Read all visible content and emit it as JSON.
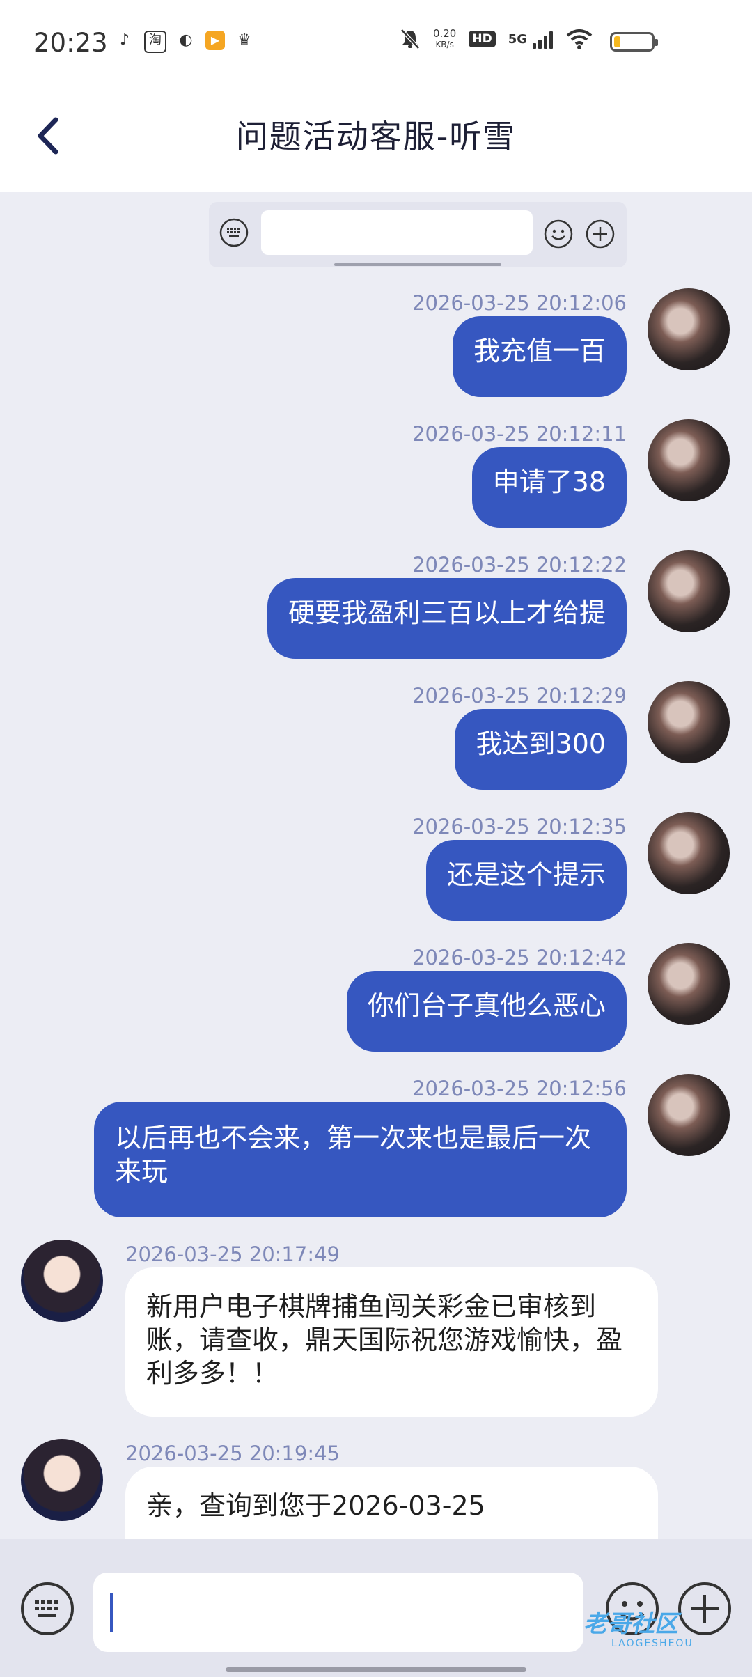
{
  "status_bar": {
    "time": "20:23",
    "apps": [
      "♪",
      "淘",
      "◐",
      "▶",
      "♛"
    ],
    "net_speed": "0.20",
    "net_unit": "KB/s",
    "hd": "HD",
    "network": "5G",
    "battery_level": 0.18,
    "battery_color": "#f5b81f"
  },
  "header": {
    "title": "问题活动客服-听雪"
  },
  "messages": [
    {
      "timestamp": "2026-03-25 20:12:06",
      "text": "我充值一百"
    },
    {
      "timestamp": "2026-03-25 20:12:11",
      "text": "申请了38"
    },
    {
      "timestamp": "2026-03-25 20:12:22",
      "text": "硬要我盈利三百以上才给提"
    },
    {
      "timestamp": "2026-03-25 20:12:29",
      "text": "我达到300"
    },
    {
      "timestamp": "2026-03-25 20:12:35",
      "text": "还是这个提示"
    },
    {
      "timestamp": "2026-03-25 20:12:42",
      "text": "你们台子真他么恶心"
    },
    {
      "timestamp": "2026-03-25 20:12:56",
      "text": "以后再也不会来，第一次来也是最后一次来玩"
    },
    {
      "timestamp": "2026-03-25 20:17:49",
      "text": "新用户电子棋牌捕鱼闯关彩金已审核到账，请查收，鼎天国际祝您游戏愉快，盈利多多！！"
    },
    {
      "timestamp": "2026-03-25 20:19:45",
      "text": "亲，查询到您于2026-03-25"
    }
  ],
  "watermark": {
    "text": "老哥社区",
    "sub": "LAOGESHEOU"
  },
  "colors": {
    "accent": "#3657c0",
    "timestamp": "#7e88b8",
    "background": "#ecedf4"
  },
  "icons": {
    "back": "chevron-left-icon",
    "keyboard": "keyboard-icon",
    "emoji": "smiley-icon",
    "plus": "plus-icon"
  }
}
